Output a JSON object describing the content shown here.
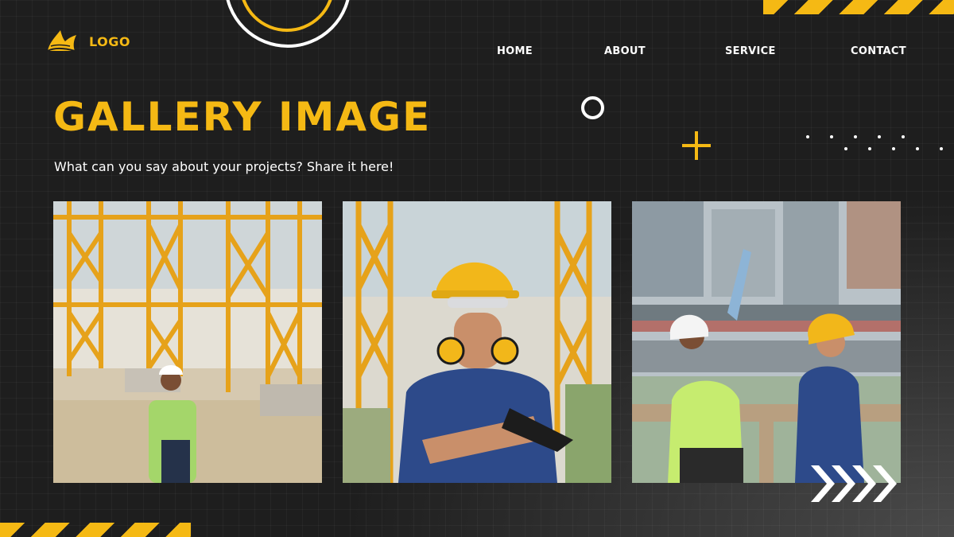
{
  "logo": {
    "text": "LOGO",
    "icon": "crown-icon"
  },
  "nav": {
    "items": [
      {
        "label": "HOME"
      },
      {
        "label": "ABOUT"
      },
      {
        "label": "SERVICE"
      },
      {
        "label": "CONTACT"
      }
    ]
  },
  "hero": {
    "title": "GALLERY IMAGE",
    "subtitle": "What can you say about your projects? Share it here!"
  },
  "gallery": {
    "images": [
      {
        "name": "construction-worker-woman-scaffolding-photo"
      },
      {
        "name": "construction-worker-man-hardhat-photo"
      },
      {
        "name": "construction-workers-pointing-photo"
      }
    ]
  },
  "decor": {
    "arrows_icon": "chevrons-right-icon"
  },
  "colors": {
    "accent": "#f5b914",
    "background": "#1e1e1e",
    "text": "#ffffff"
  }
}
